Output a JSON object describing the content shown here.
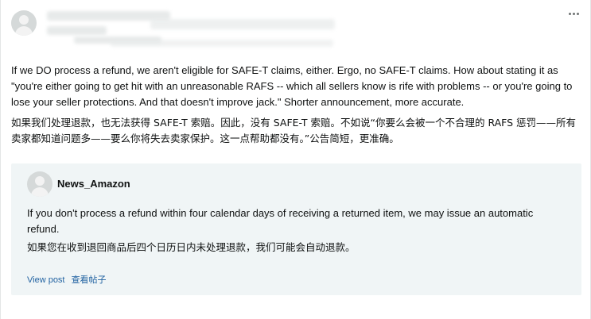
{
  "post": {
    "author_avatar_icon": "user-avatar-icon",
    "more_icon": "more-options-icon",
    "text_en": "If we DO process a refund, we aren't eligible for SAFE-T claims, either. Ergo, no SAFE-T claims. How about stating it as \"you're either going to get hit with an unreasonable RAFS -- which all sellers know is rife with problems -- or you're going to lose your seller protections. And that doesn't improve jack.\" Shorter announcement, more accurate.",
    "text_zh": "如果我们处理退款，也无法获得 SAFE-T 索赔。因此，没有 SAFE-T 索赔。不如说“你要么会被一个不合理的 RAFS 惩罚——所有卖家都知道问题多——要么你将失去卖家保护。这一点帮助都没有。”公告简短，更准确。"
  },
  "quote": {
    "author": "News_Amazon",
    "avatar_icon": "user-avatar-icon",
    "text_en": "If you don't process a refund within four calendar days of receiving a returned item, we may issue an automatic refund.",
    "text_zh": "如果您在收到退回商品后四个日历日内未处理退款，我们可能会自动退款。",
    "view_post_en": "View post",
    "view_post_zh": "查看帖子"
  },
  "colors": {
    "link": "#2162a1",
    "quote_background": "#f0f5f6",
    "avatar_background": "#d5d9d9"
  }
}
